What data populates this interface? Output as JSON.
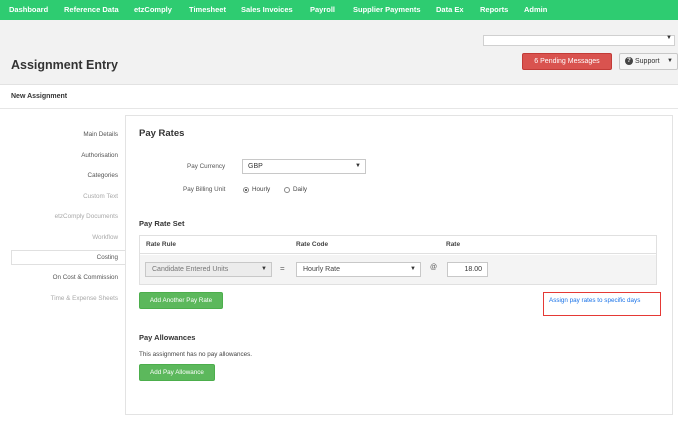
{
  "nav": {
    "items": [
      "Dashboard",
      "Reference Data",
      "etzComply",
      "Timesheet",
      "Sales Invoices",
      "Payroll",
      "Supplier Payments",
      "Data Ex",
      "Reports",
      "Admin"
    ]
  },
  "header": {
    "title": "Assignment Entry",
    "pending_messages": "6 Pending Messages",
    "support": "Support"
  },
  "section_title": "New Assignment",
  "sidebar": {
    "items": [
      {
        "label": "Main Details",
        "state": "normal"
      },
      {
        "label": "Authorisation",
        "state": "normal"
      },
      {
        "label": "Categories",
        "state": "normal"
      },
      {
        "label": "Custom Text",
        "state": "muted"
      },
      {
        "label": "etzComply Documents",
        "state": "muted"
      },
      {
        "label": "Workflow",
        "state": "muted"
      },
      {
        "label": "Costing",
        "state": "active"
      },
      {
        "label": "On Cost & Commission",
        "state": "normal"
      },
      {
        "label": "Time & Expense Sheets",
        "state": "muted"
      }
    ]
  },
  "pay_rates": {
    "heading": "Pay Rates",
    "currency_label": "Pay Currency",
    "currency_value": "GBP",
    "billing_unit_label": "Pay Billing Unit",
    "billing_options": [
      "Hourly",
      "Daily"
    ],
    "billing_selected": "Hourly"
  },
  "rate_set": {
    "heading": "Pay Rate Set",
    "columns": [
      "Rate Rule",
      "Rate Code",
      "Rate"
    ],
    "row": {
      "rule": "Candidate Entered Units",
      "operator": "=",
      "code": "Hourly Rate",
      "at": "@",
      "rate": "18.00"
    },
    "add_button": "Add Another Pay Rate",
    "assign_link": "Assign pay rates to specific days"
  },
  "allowances": {
    "heading": "Pay Allowances",
    "note": "This assignment has no pay allowances.",
    "add_button": "Add Pay Allowance"
  },
  "colors": {
    "nav_bg": "#2ecc71",
    "danger": "#d9534f",
    "success": "#5cb85c",
    "link": "#1a73e8",
    "highlight_border": "#e53935"
  }
}
